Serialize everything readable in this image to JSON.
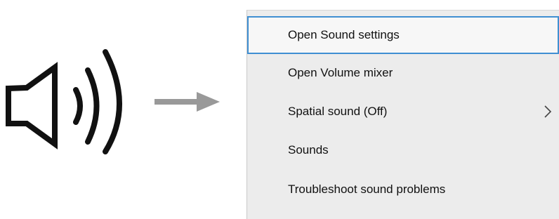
{
  "icons": {
    "speaker": "speaker-volume-icon",
    "arrow": "arrow-right-icon",
    "submenu": "chevron-right-icon"
  },
  "colors": {
    "menu_background": "#ececec",
    "selection_border": "#3f8fd2",
    "arrow": "#999999",
    "text": "#111111"
  },
  "menu": {
    "items": [
      {
        "label": "Open Sound settings"
      },
      {
        "label": "Open Volume mixer"
      },
      {
        "label": "Spatial sound (Off)"
      },
      {
        "label": "Sounds"
      },
      {
        "label": "Troubleshoot sound problems"
      }
    ]
  }
}
